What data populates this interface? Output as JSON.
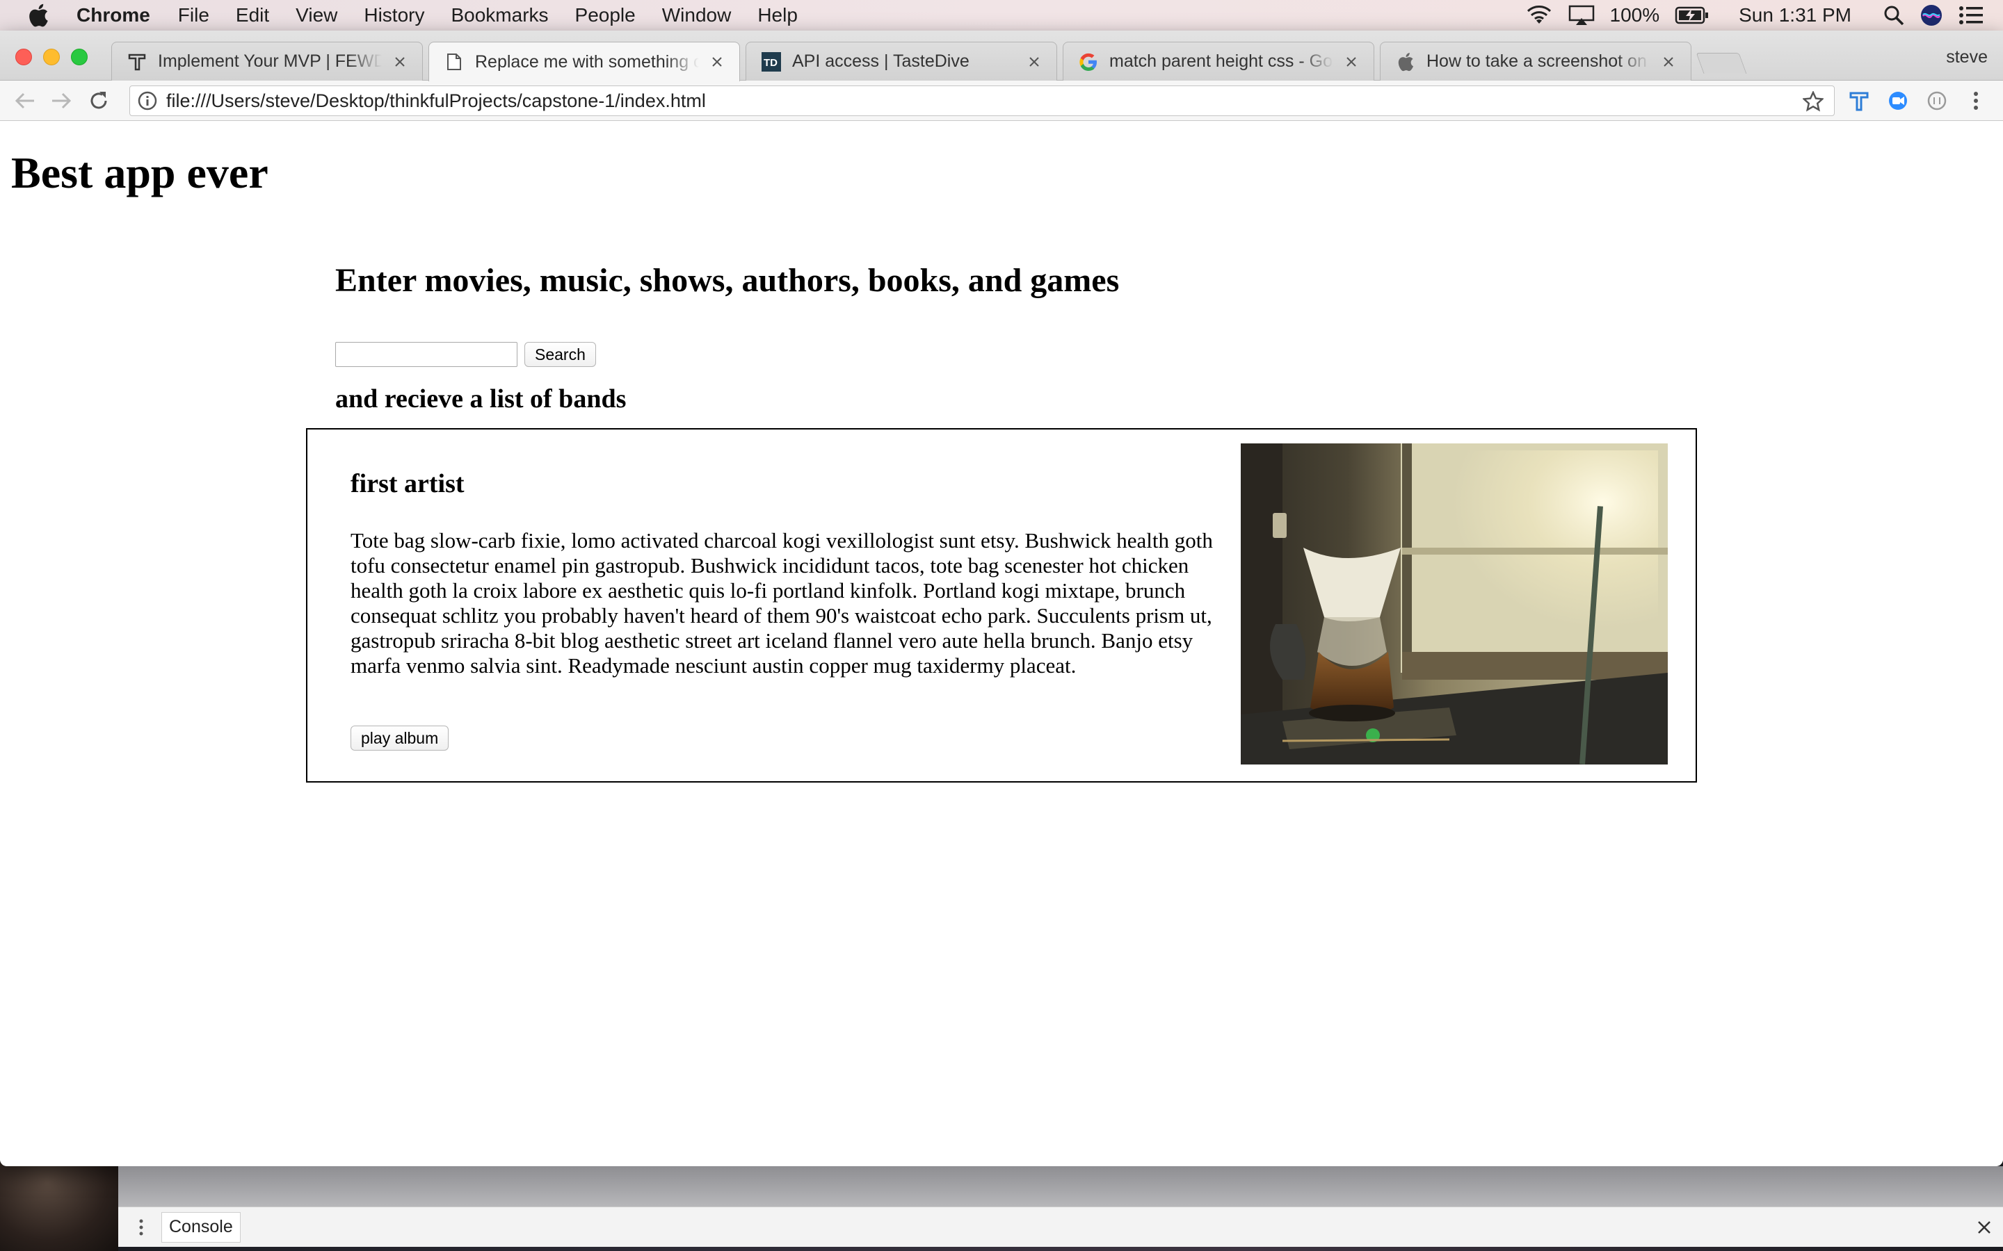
{
  "menubar": {
    "app_name": "Chrome",
    "items": [
      "File",
      "Edit",
      "View",
      "History",
      "Bookmarks",
      "People",
      "Window",
      "Help"
    ],
    "battery": "100%",
    "clock": "Sun 1:31 PM"
  },
  "browser": {
    "profile_name": "steve",
    "tabs": [
      {
        "title": "Implement Your MVP | FEWD-Capstone",
        "favicon": "thinkful-icon",
        "active": false
      },
      {
        "title": "Replace me with something clever",
        "favicon": "document-icon",
        "active": true
      },
      {
        "title": "API access | TasteDive",
        "favicon": "tastedive-icon",
        "active": false
      },
      {
        "title": "match parent height css - Google Search",
        "favicon": "google-icon",
        "active": false
      },
      {
        "title": "How to take a screenshot on your Mac",
        "favicon": "apple-icon",
        "active": false
      }
    ],
    "url": "file:///Users/steve/Desktop/thinkfulProjects/capstone-1/index.html"
  },
  "page": {
    "title": "Best app ever",
    "heading": "Enter movies, music, shows, authors, books, and games",
    "search": {
      "value": "",
      "placeholder": "",
      "button_label": "Search"
    },
    "subheading": "and recieve a list of bands",
    "results": [
      {
        "name": "first artist",
        "description": "Tote bag slow-carb fixie, lomo activated charcoal kogi vexillologist sunt etsy. Bushwick health goth tofu consectetur enamel pin gastropub. Bushwick incididunt tacos, tote bag scenester hot chicken health goth la croix labore ex aesthetic quis lo-fi portland kinfolk. Portland kogi mixtape, brunch consequat schlitz you probably haven't heard of them 90's waistcoat echo park. Succulents prism ut, gastropub sriracha 8-bit blog aesthetic street art iceland flannel vero aute hella brunch. Banjo etsy marfa venmo salvia sint. Readymade nesciunt austin copper mug taxidermy placeat.",
        "button_label": "play album",
        "image": "coffee-pour-over-by-window-photo"
      }
    ]
  },
  "devtools": {
    "tab_label": "Console"
  }
}
